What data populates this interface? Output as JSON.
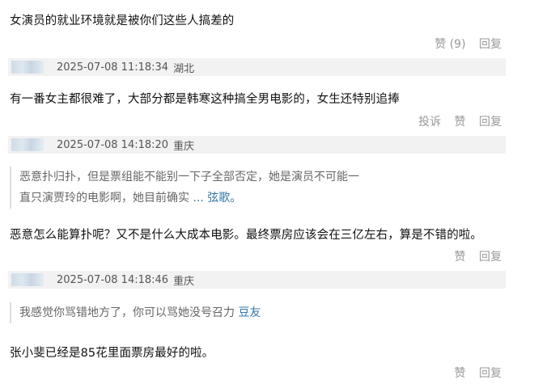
{
  "comments": [
    {
      "text": "女演员的就业环境就是被你们这些人搞差的",
      "actions": {
        "like": "赞 (9)",
        "reply": "回复"
      }
    },
    {
      "meta": {
        "time": "2025-07-08 11:18:34",
        "location": "湖北"
      },
      "text": "有一番女主都很难了，大部分都是韩寒这种搞全男电影的，女生还特别追捧",
      "actions": {
        "report": "投诉",
        "like": "赞",
        "reply": "回复"
      }
    },
    {
      "meta": {
        "time": "2025-07-08 14:18:20",
        "location": "重庆"
      },
      "quote": {
        "line1": "恶意扑归扑，但是票组能不能别一下子全部否定，她是演员不可能一",
        "line2": "直只演贾玲的电影啊，她目前确实",
        "link": "... 弦歌。"
      },
      "text": "恶意怎么能算扑呢？又不是什么大成本电影。最终票房应该会在三亿左右，算是不错的啦。",
      "actions": {
        "like": "赞",
        "reply": "回复"
      }
    },
    {
      "meta": {
        "time": "2025-07-08 14:18:46",
        "location": "重庆"
      },
      "quote": {
        "line1": "我感觉你骂错地方了，你可以骂她没号召力",
        "link": "豆友"
      },
      "text": "张小斐已经是85花里面票房最好的啦。",
      "actions": {
        "like": "赞",
        "reply": "回复"
      }
    }
  ]
}
